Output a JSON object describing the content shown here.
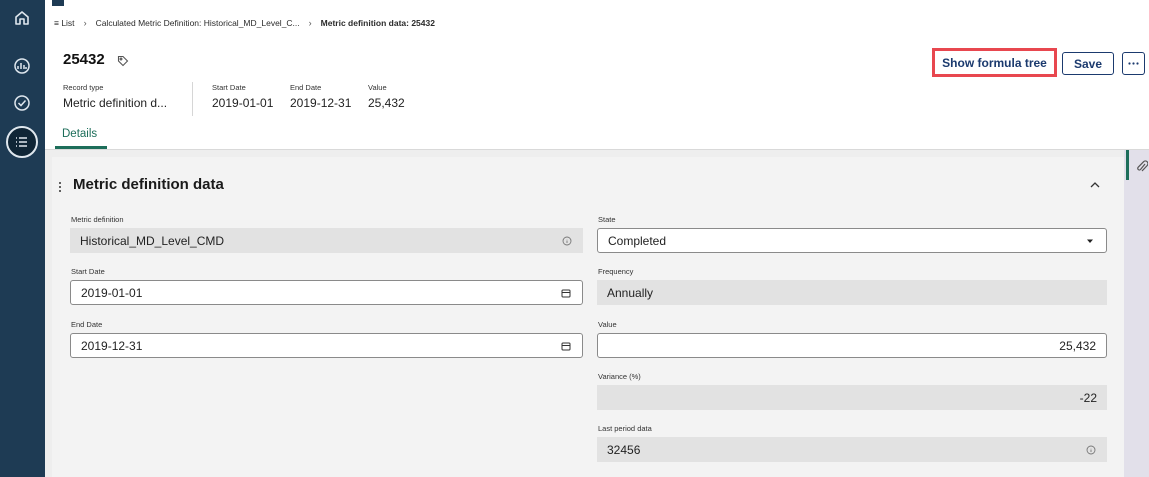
{
  "nav": {
    "items": [
      {
        "name": "home"
      },
      {
        "name": "dashboard"
      },
      {
        "name": "check"
      },
      {
        "name": "list",
        "active": true
      }
    ]
  },
  "breadcrumb": {
    "list_label": "≡ List",
    "parent_label": "Calculated Metric Definition: Historical_MD_Level_C...",
    "current_label": "Metric definition data: 25432"
  },
  "header": {
    "title": "25432",
    "record_type_label": "Record type",
    "record_type_value": "Metric definition d...",
    "start_date_label": "Start Date",
    "start_date_value": "2019-01-01",
    "end_date_label": "End Date",
    "end_date_value": "2019-12-31",
    "value_label": "Value",
    "value_value": "25,432"
  },
  "actions": {
    "show_formula_tree": "Show formula tree",
    "save": "Save"
  },
  "tabs": [
    {
      "label": "Details",
      "active": true
    }
  ],
  "section": {
    "title": "Metric definition data",
    "fields": {
      "metric_definition": {
        "label": "Metric definition",
        "value": "Historical_MD_Level_CMD"
      },
      "state": {
        "label": "State",
        "value": "Completed"
      },
      "start_date": {
        "label": "Start Date",
        "value": "2019-01-01"
      },
      "frequency": {
        "label": "Frequency",
        "value": "Annually"
      },
      "end_date": {
        "label": "End Date",
        "value": "2019-12-31"
      },
      "value": {
        "label": "Value",
        "value": "25,432"
      },
      "variance": {
        "label": "Variance (%)",
        "value": "-22"
      },
      "last_period_data": {
        "label": "Last period data",
        "value": "32456"
      }
    }
  },
  "colors": {
    "nav_bg": "#1e3b54",
    "accent_green": "#1d6e5a",
    "button_text": "#1b3a6e",
    "highlight_border": "#e8474f"
  }
}
